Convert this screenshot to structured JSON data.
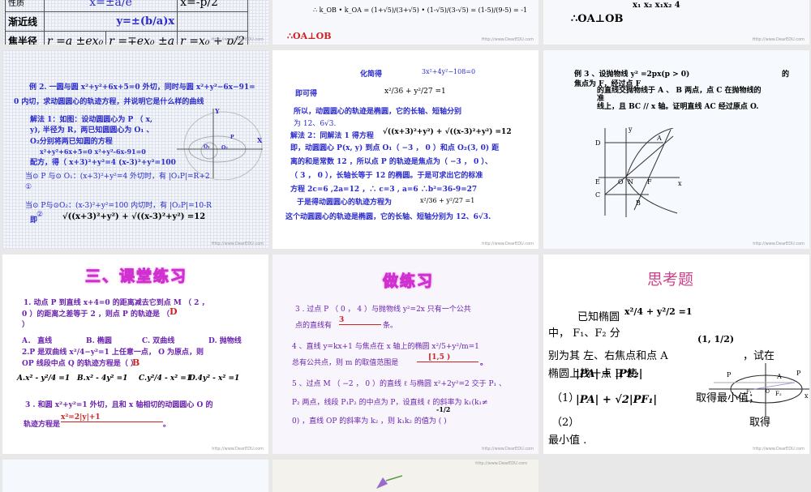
{
  "slide1": {
    "row0": [
      "性质",
      "x=±a/e",
      "x=-p/2"
    ],
    "asymptote_label": "渐近线",
    "asymptote_value": "y=±(b/a)x",
    "focal_label": "焦半径",
    "focal_values": [
      "r =a ±ex₀",
      "r =∓ex₀ ±a",
      "r =x₀ + p/2"
    ],
    "watermark": "Http://www.DearEDU.com"
  },
  "slide2": {
    "formula": "∴ k_OB • k_OA = (1+√5)/(3+√5) • (1-√5)/(3-√5) = (1-5)/(9-5) = -1",
    "conclusion": "∴OA⊥OB",
    "watermark": "Http://www.DearEDU.com"
  },
  "slide3": {
    "top": "x₁   x₂    x₁x₂     4",
    "conclusion": "∴OA⊥OB"
  },
  "slide4": {
    "lines": [
      "例 2. 一圆与圆 x²+y²+6x+5=0 外切，同时与圆 x²+y²−6x−91=",
      "0 内切，求动圆圆心的轨迹方程，并说明它是什么样的曲线",
      "解法 1：如图：设动圆圆心为 P （ x,",
      "y), 半径为 R，两已知圆圆心为 O₁ 、",
      "O₂分别将两已知圆的方程",
      "x²+y²+6x+5=0   x²+y²-6x-91=0",
      "配方，得（ x+3)²+y²=4   (x-3)²+y²=100",
      "当⊙ P 与⊙ O₁：(x+3)²+y²=4 外切时，有    |O₁P|=R+2",
      "①",
      "当⊙ P与⊙O₂：(x-3)²+y²=100 内切时，有 |O₂P|=10-R",
      "②",
      "即",
      "√((x+3)²+y²) + √((x-3)²+y²) =12"
    ],
    "labels": [
      "Y",
      "X",
      "P",
      "O₁",
      "O₂"
    ],
    "watermark": "Http://www.DearEDU.com"
  },
  "slide5": {
    "lines": [
      "化简得",
      "3x²+4y²−108=0",
      "即可得",
      "x²/36 + y²/27 =1",
      "所以，动圆圆心的轨迹是椭圆，它的长轴、短轴分别",
      "为  12、6√3.",
      "解法 2：同解法 1 得方程",
      "√((x+3)²+y²) + √((x-3)²+y²) =12",
      "即，动圆圆心 P(x, y) 到点 O₁（ −3 ， 0 ）和点 O₂(3, 0) 距",
      "离的和是常数 12 ，所以点 P 的轨迹是焦点为（ −3 ， 0 ）、",
      "（ 3 ， 0 ），长轴长等于 12 的椭圆。于是可求出它的标准",
      "方程 2c=6 ,2a=12 ，∴ c=3 , a=6      ∴b²=36-9=27",
      "于是得动圆圆心的轨迹方程为",
      "x²/36 + y²/27 =1",
      "这个动圆圆心的轨迹是椭圆，它的长轴、短轴分别为 12、6√3."
    ],
    "watermark": "http://www.DearEDU.com"
  },
  "slide6": {
    "lines": [
      "例 3 、设抛物线 y² =2px(p > 0)",
      "的",
      "焦点为 F，经过点 F",
      "的直线交抛物线于 A 、 B 两点，点 C 在抛物线的",
      "准",
      "线上，且 BC // x 轴。证明直线 AC 经过原点 O."
    ],
    "labels": [
      "y",
      "D",
      "A",
      "E",
      "O",
      "N",
      "F",
      "x",
      "C",
      "B"
    ],
    "watermark": "http://www.DearEDU.com"
  },
  "slide7": {
    "title": "三、课堂练习",
    "lines": [
      "1. 动点 P 到直线  x+4=0 的距离减去它到点 M （ 2 ，",
      "0 ）的距离之差等于 2 ，则点 P 的轨迹是            （",
      "）",
      "A． 直线",
      "B. 椭圆",
      "C. 双曲线",
      "D. 抛物线",
      "2.P 是双曲线    x²/4−y²=1 上任意一点， O 为原点，则",
      "OP 线段中点 Q 的轨迹方程是（        ）",
      "A.x² - y²/4 =1",
      "B.x² - 4y² =1",
      "C.y²/4 - x² =1",
      "D.4y² - x² =1",
      "3 . 和圆 x²+y²=1 外切，且和 x 轴相切的动圆圆心 O 的",
      "轨迹方程是",
      "。"
    ],
    "answers": [
      "D",
      "B",
      "x²=2|y|+1"
    ],
    "watermark": "http://www.DearEDU.com"
  },
  "slide8": {
    "title": "做练习",
    "lines": [
      "3 . 过点 P （  0  ，   4  ）与抛物线 y²=2x 只有一个公共",
      "点的直线有",
      "条。",
      "4 、直线  y=kx+1 与焦点在 x 轴上的椭圆  x²/5+y²/m=1",
      "总有公共点，则 m 的取值范围是",
      "。",
      "5 、过点 M （ −2 ， 0 ）的直线 ℓ 与椭圆  x²+2y²=2  交于 P₁ 、",
      "P₂ 两点，线段 P₁P₂ 的中点为 P，设直线 ℓ 的斜率为 k₁(k₁≠",
      "0) ，直线 OP 的斜率为 k₂ ，则  k₁k₂ 的值为      (        )"
    ],
    "answers": [
      "3",
      "[1,5 )",
      "-1/2"
    ],
    "watermark": "http://www.DearEDU.com"
  },
  "slide9": {
    "title": "思考题",
    "lines": [
      "已知椭圆",
      "x²/4 + y²/2 =1",
      "中， F₁、F₂ 分",
      "别为其  左、右焦点和点 A",
      "(1, 1/2)",
      "，试在",
      "椭圆上找一点  P, 使",
      "（1）",
      "|PA| + |PF₂|",
      "取得最小值；",
      "（2）",
      "|PA| + √2|PF₁|",
      "取得",
      "最小值 ."
    ],
    "labels": [
      "P",
      "A",
      "P",
      "F₁",
      "O",
      "F₂",
      "x"
    ],
    "watermark": "http://www.DearEDU.com"
  },
  "slide11": {
    "watermark": "http://www.DearEDU.com"
  }
}
